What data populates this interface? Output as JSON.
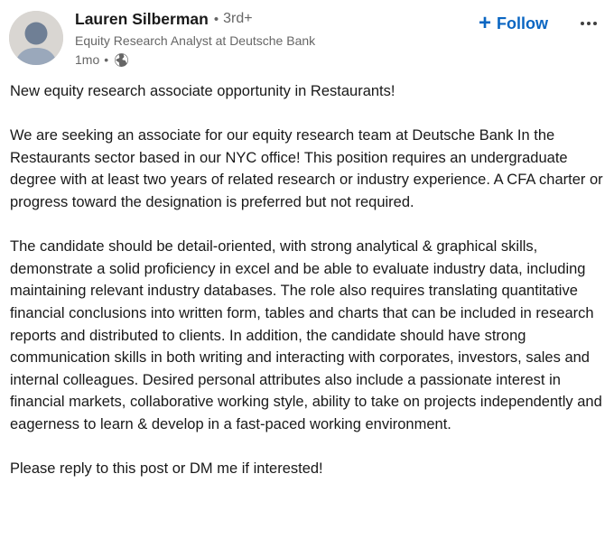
{
  "author": {
    "name": "Lauren Silberman",
    "separator": "•",
    "degree": "3rd+",
    "headline": "Equity Research Analyst at Deutsche Bank",
    "time": "1mo",
    "time_separator": "•",
    "visibility_icon": "globe-icon"
  },
  "actions": {
    "follow_icon": "plus-icon",
    "follow_label": "Follow",
    "more_icon": "ellipsis-icon"
  },
  "post": {
    "paragraphs": [
      "New equity research associate opportunity in Restaurants!",
      "We are seeking an associate for our equity research team at Deutsche Bank In the Restaurants sector based in our NYC office! This position requires an undergraduate degree with at least two years of related research or industry experience. A CFA charter or progress toward the designation is preferred but not required.",
      "The candidate should be detail-oriented, with strong analytical & graphical skills, demonstrate a solid proficiency in excel and be able to evaluate industry data, including maintaining relevant industry databases. The role also requires translating quantitative financial conclusions into written form, tables and charts that can be included in research reports and distributed to clients. In addition, the candidate should have strong communication skills in both writing and interacting with corporates, investors, sales and internal colleagues. Desired personal attributes also include a passionate interest in financial markets, collaborative working style, ability to take on projects independently and eagerness to learn & develop in a fast-paced working environment.",
      "Please reply to this post or DM me if interested!"
    ]
  },
  "colors": {
    "accent": "#0a66c2",
    "text_primary": "#191919",
    "text_secondary": "#666666",
    "avatar_bg": "#d9d6d2",
    "avatar_figure": "#9aa8bb"
  }
}
